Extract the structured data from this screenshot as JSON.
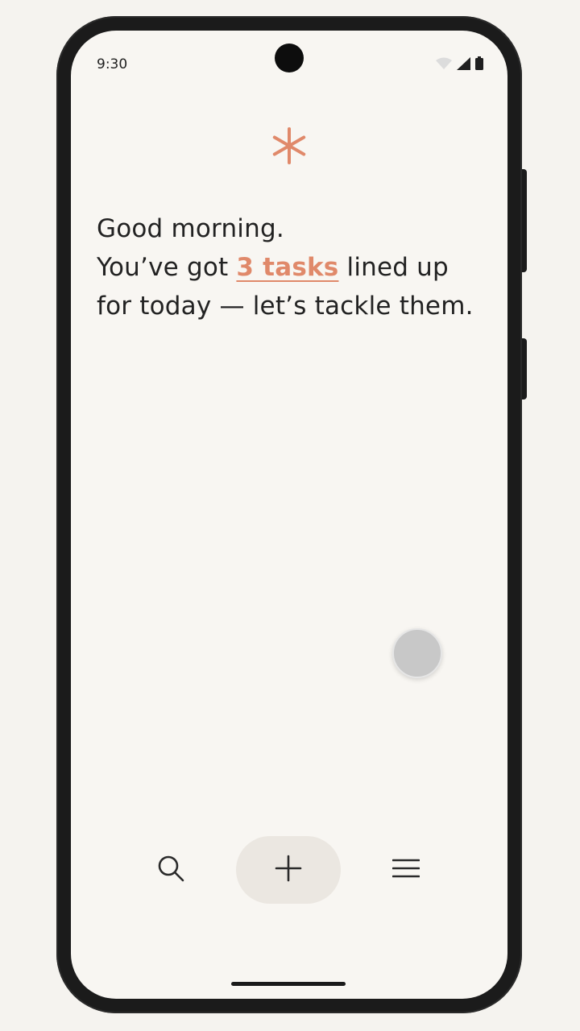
{
  "status_bar": {
    "time": "9:30",
    "icons": [
      "wifi-icon",
      "signal-icon",
      "battery-icon"
    ]
  },
  "app": {
    "logo_icon": "asterisk-icon",
    "accent_color": "#e0896a",
    "greeting": {
      "line1": "Good morning.",
      "line2_prefix": "You’ve got ",
      "tasks_link": "3 tasks",
      "line2_suffix": " lined up",
      "line3": "for today — let’s tackle them."
    }
  },
  "bottom_nav": {
    "search_icon": "search-icon",
    "add_icon": "plus-icon",
    "menu_icon": "menu-icon"
  }
}
